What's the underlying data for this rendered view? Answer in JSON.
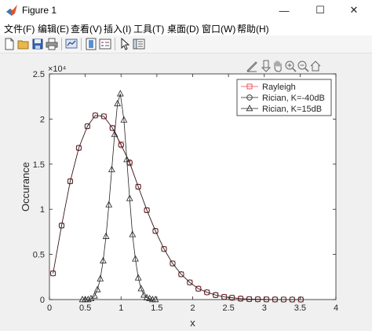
{
  "window": {
    "title": "Figure 1",
    "minimize_glyph": "—",
    "maximize_glyph": "☐",
    "close_glyph": "✕"
  },
  "menu": [
    {
      "label": "文件(F)",
      "id": "file"
    },
    {
      "label": "编辑(E)",
      "id": "edit"
    },
    {
      "label": "查看(V)",
      "id": "view"
    },
    {
      "label": "插入(I)",
      "id": "insert"
    },
    {
      "label": "工具(T)",
      "id": "tools"
    },
    {
      "label": "桌面(D)",
      "id": "desktop"
    },
    {
      "label": "窗口(W)",
      "id": "window"
    },
    {
      "label": "帮助(H)",
      "id": "help"
    }
  ],
  "toolbar_icons": [
    "new-figure-icon",
    "open-file-icon",
    "save-icon",
    "print-icon",
    "link-plot-icon",
    "colorbar-icon",
    "legend-icon",
    "select-arrow-icon",
    "property-inspector-icon"
  ],
  "axes_toolbar_icons": [
    "brush-icon",
    "data-tips-icon",
    "pan-icon",
    "zoom-in-icon",
    "zoom-out-icon",
    "home-icon"
  ],
  "chart_data": {
    "type": "line",
    "xlabel": "x",
    "ylabel": "Occurance",
    "exponent_label": "×10⁴",
    "xlim": [
      0,
      4
    ],
    "ylim": [
      0,
      2.5
    ],
    "xticks": [
      "0",
      "0.5",
      "1",
      "1.5",
      "2",
      "2.5",
      "3",
      "3.5",
      "4"
    ],
    "yticks": [
      "0",
      "0.5",
      "1",
      "1.5",
      "2",
      "2.5"
    ],
    "grid": false,
    "legend_position": "top-right",
    "series": [
      {
        "name": "Rayleigh",
        "color": "#e8474f",
        "marker": "square",
        "x": [
          0.05,
          0.17,
          0.29,
          0.41,
          0.53,
          0.64,
          0.76,
          0.88,
          1.0,
          1.12,
          1.24,
          1.36,
          1.48,
          1.6,
          1.72,
          1.84,
          1.96,
          2.08,
          2.2,
          2.32,
          2.44,
          2.55,
          2.67,
          2.79,
          2.91,
          3.03,
          3.15,
          3.27,
          3.39,
          3.51
        ],
        "y": [
          0.29,
          0.82,
          1.31,
          1.68,
          1.92,
          2.04,
          2.03,
          1.9,
          1.72,
          1.51,
          1.25,
          0.99,
          0.76,
          0.56,
          0.4,
          0.28,
          0.19,
          0.12,
          0.08,
          0.05,
          0.03,
          0.02,
          0.01,
          0.005,
          0.003,
          0.002,
          0.001,
          0.0005,
          0.0003,
          0.0002
        ]
      },
      {
        "name": "Rician, K=-40dB",
        "color": "#222222",
        "marker": "circle",
        "x": [
          0.05,
          0.17,
          0.29,
          0.41,
          0.53,
          0.64,
          0.76,
          0.88,
          1.0,
          1.12,
          1.24,
          1.36,
          1.48,
          1.6,
          1.72,
          1.84,
          1.96,
          2.08,
          2.2,
          2.32,
          2.44,
          2.55,
          2.67,
          2.79,
          2.91,
          3.03,
          3.15,
          3.27,
          3.39,
          3.51
        ],
        "y": [
          0.29,
          0.82,
          1.31,
          1.68,
          1.92,
          2.04,
          2.03,
          1.9,
          1.71,
          1.52,
          1.25,
          0.99,
          0.76,
          0.56,
          0.4,
          0.28,
          0.19,
          0.12,
          0.08,
          0.05,
          0.03,
          0.02,
          0.01,
          0.005,
          0.003,
          0.002,
          0.001,
          0.0005,
          0.0003,
          0.0002
        ]
      },
      {
        "name": "Rician, K=15dB",
        "color": "#222222",
        "marker": "triangle",
        "x": [
          0.46,
          0.5,
          0.54,
          0.58,
          0.63,
          0.67,
          0.71,
          0.75,
          0.79,
          0.83,
          0.87,
          0.91,
          0.95,
          0.99,
          1.04,
          1.08,
          1.12,
          1.16,
          1.2,
          1.24,
          1.28,
          1.32,
          1.36,
          1.4,
          1.44,
          1.48
        ],
        "y": [
          0.0,
          0.0,
          0.0,
          0.01,
          0.04,
          0.11,
          0.23,
          0.43,
          0.7,
          1.05,
          1.44,
          1.83,
          2.17,
          2.28,
          1.99,
          1.55,
          1.12,
          0.72,
          0.45,
          0.24,
          0.12,
          0.05,
          0.02,
          0.01,
          0.0,
          0.0
        ]
      }
    ]
  }
}
